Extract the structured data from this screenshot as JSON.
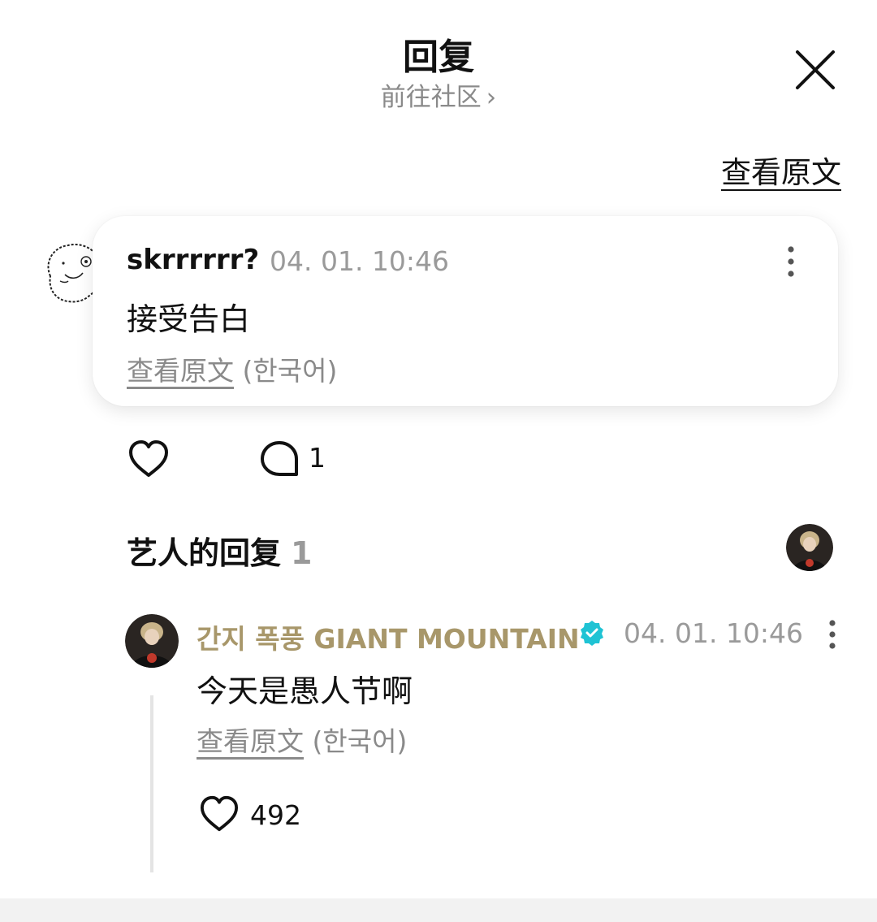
{
  "header": {
    "title": "回复",
    "subtitle": "前往社区",
    "subtitle_chevron": "›",
    "close_icon": "close-icon"
  },
  "view_original_top": "查看原文",
  "comment": {
    "username": "skrrrrrr?",
    "timestamp": "04. 01. 10:46",
    "text": "接受告白",
    "view_original": "查看原文",
    "language": "(한국어)",
    "avatar_icon": "doodle-face-avatar",
    "reply_count": "1"
  },
  "artist_section": {
    "title": "艺人的回复",
    "count": "1"
  },
  "artist_reply": {
    "name": "간지 폭풍 GIANT MOUNTAIN",
    "timestamp": "04. 01. 10:46",
    "text": "今天是愚人节啊",
    "view_original": "查看原文",
    "language": "(한국어)",
    "like_count": "492",
    "verified_icon": "verified-badge-icon"
  },
  "colors": {
    "artist_name": "#a8976a",
    "verified": "#1fc3d4",
    "muted_text": "#8a8a8a"
  }
}
